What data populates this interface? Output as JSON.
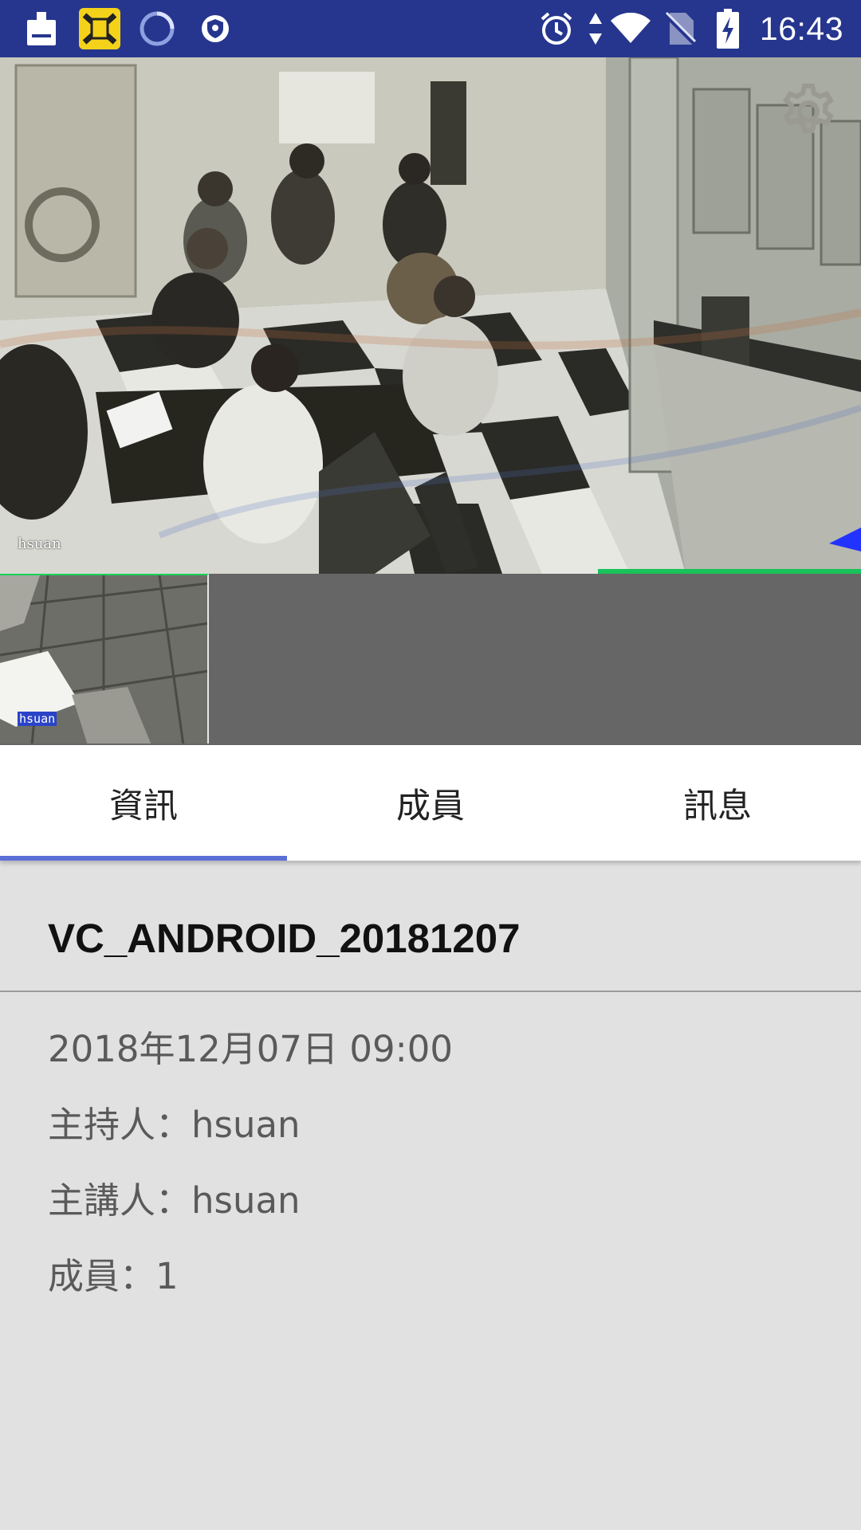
{
  "status_bar": {
    "time": "16:43",
    "icons": [
      "cleaner-icon",
      "app-icon",
      "loading-icon",
      "shield-icon",
      "alarm-icon",
      "data-arrows-icon",
      "wifi-icon",
      "no-sim-icon",
      "battery-charging-icon"
    ]
  },
  "video": {
    "main_label": "hsuan",
    "thumbnail_label": "hsuan",
    "settings_icon": "gear-icon"
  },
  "tabs": [
    {
      "label": "資訊",
      "selected": true
    },
    {
      "label": "成員",
      "selected": false
    },
    {
      "label": "訊息",
      "selected": false
    }
  ],
  "meeting": {
    "title": "VC_ANDROID_20181207",
    "datetime": "2018年12月07日 09:00",
    "host": "主持人：hsuan",
    "presenter": "主講人：hsuan",
    "members": "成員：1"
  },
  "colors": {
    "status_bar": "#26368e",
    "tab_indicator": "#5b6fd6",
    "background": "#e1e1e1",
    "thumb_strip": "#666666"
  }
}
